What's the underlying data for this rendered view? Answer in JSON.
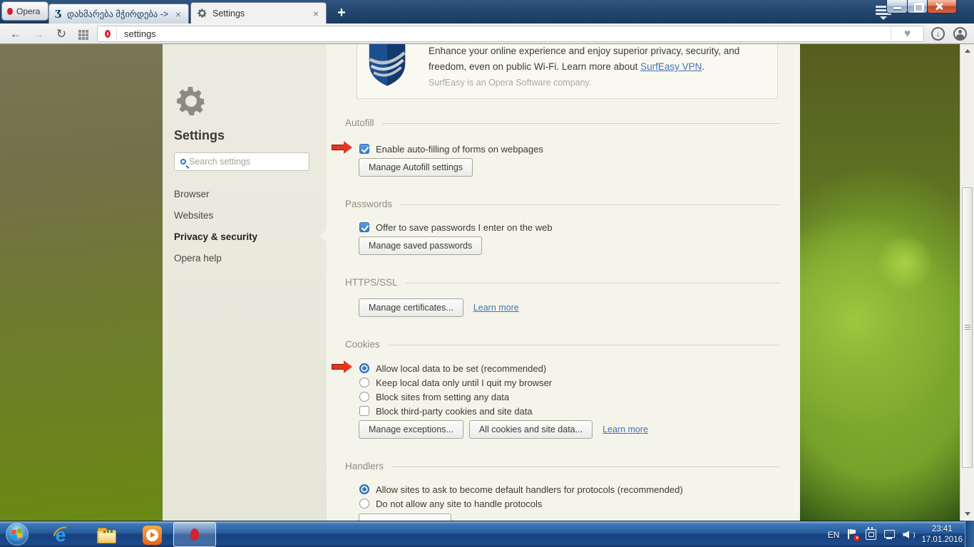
{
  "window": {
    "opera_button_label": "Opera",
    "tabs": [
      {
        "label": "დახმარება მჭირდება ->",
        "favicon": "forum-logo",
        "close_glyph": "×"
      },
      {
        "label": "Settings",
        "favicon": "gear",
        "close_glyph": "×"
      }
    ],
    "new_tab_glyph": "+"
  },
  "toolbar": {
    "address_value": "settings"
  },
  "icons": {
    "back": "←",
    "forward": "→",
    "reload": "↻",
    "heart": "♥",
    "download_arrow": "↓",
    "tab1_favicon_glyph": "Ӡ",
    "tray_error_cross": "x"
  },
  "sidebar": {
    "title": "Settings",
    "search_placeholder": "Search settings",
    "items": [
      {
        "label": "Browser",
        "selected": false
      },
      {
        "label": "Websites",
        "selected": false
      },
      {
        "label": "Privacy & security",
        "selected": true
      },
      {
        "label": "Opera help",
        "selected": false
      }
    ]
  },
  "content": {
    "surfeasy": {
      "line1": "Enhance your online experience and enjoy superior privacy, security, and",
      "line2_before_link": "freedom, even on public Wi-Fi. Learn more about ",
      "line2_link": "SurfEasy VPN",
      "line2_after_link": ".",
      "byline": "SurfEasy is an Opera Software company."
    },
    "autofill": {
      "title": "Autofill",
      "checkbox_label": "Enable auto-filling of forms on webpages",
      "checkbox_checked": true,
      "button_label": "Manage Autofill settings"
    },
    "passwords": {
      "title": "Passwords",
      "checkbox_label": "Offer to save passwords I enter on the web",
      "checkbox_checked": true,
      "button_label": "Manage saved passwords"
    },
    "https_ssl": {
      "title": "HTTPS/SSL",
      "button_label": "Manage certificates...",
      "link_label": "Learn more"
    },
    "cookies": {
      "title": "Cookies",
      "options": [
        {
          "label": "Allow local data to be set (recommended)",
          "selected": true
        },
        {
          "label": "Keep local data only until I quit my browser",
          "selected": false
        },
        {
          "label": "Block sites from setting any data",
          "selected": false
        }
      ],
      "checkbox_label": "Block third-party cookies and site data",
      "checkbox_checked": false,
      "button1_label": "Manage exceptions...",
      "button2_label": "All cookies and site data...",
      "link_label": "Learn more"
    },
    "handlers": {
      "title": "Handlers",
      "options": [
        {
          "label": "Allow sites to ask to become default handlers for protocols (recommended)",
          "selected": true
        },
        {
          "label": "Do not allow any site to handle protocols",
          "selected": false
        }
      ]
    }
  },
  "taskbar": {
    "tray": {
      "language": "EN",
      "time": "23:41",
      "date": "17.01.2016"
    }
  },
  "colors": {
    "accent_checkbox_blue": "#3c7bc8",
    "annotation_arrow_red": "#e23722",
    "link_blue": "#4272b5",
    "titlebar_blue": "#24476f",
    "taskbar_blue": "#16417e"
  }
}
